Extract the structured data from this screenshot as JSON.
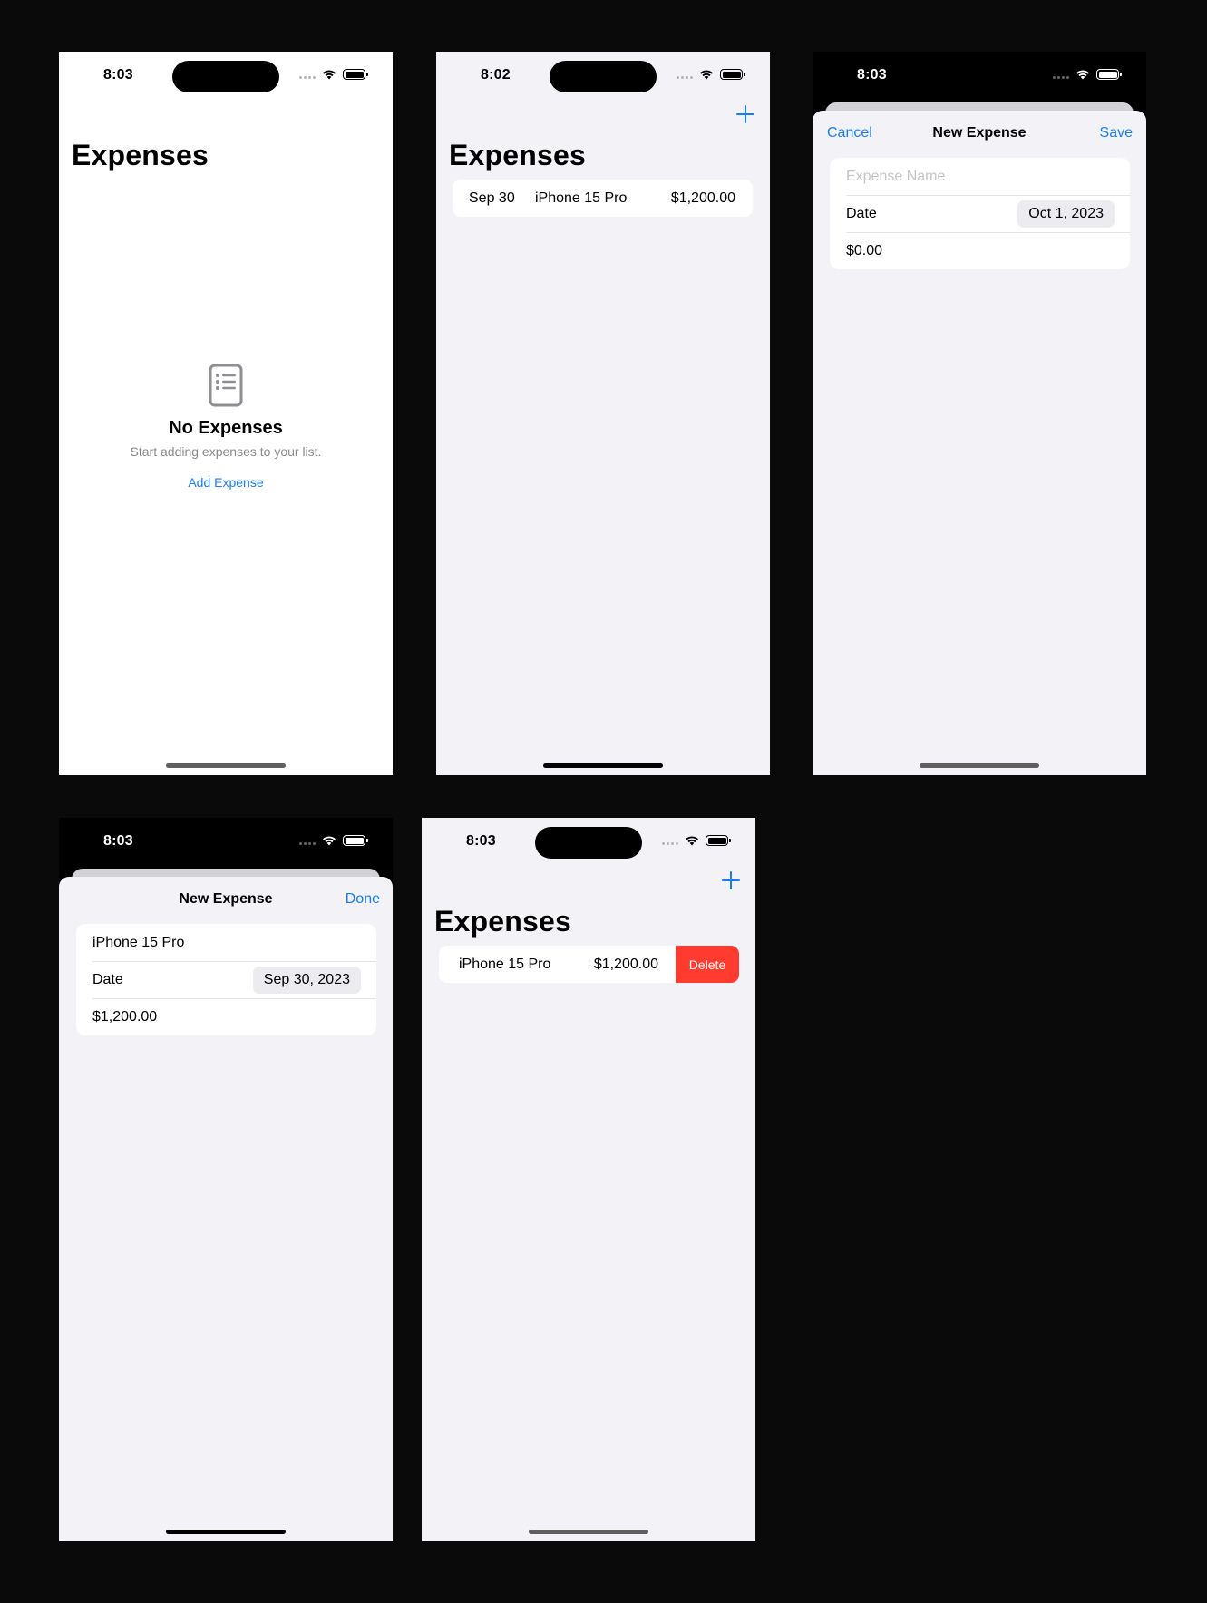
{
  "status_times": {
    "p1": "8:03",
    "p2": "8:02",
    "p3": "8:03",
    "p4": "8:03",
    "p5": "8:03"
  },
  "nav_title": "Expenses",
  "empty_state": {
    "icon": "list-document-icon",
    "title": "No Expenses",
    "subtitle": "Start adding expenses to your list.",
    "button": "Add Expense"
  },
  "list": {
    "row": {
      "date": "Sep 30",
      "name": "iPhone 15 Pro",
      "amount": "$1,200.00"
    }
  },
  "new_sheet": {
    "cancel": "Cancel",
    "title": "New Expense",
    "save": "Save",
    "name_placeholder": "Expense Name",
    "date_label": "Date",
    "date_value": "Oct 1, 2023",
    "amount_value": "$0.00"
  },
  "edit_sheet": {
    "title": "New Expense",
    "done": "Done",
    "name_value": "iPhone 15 Pro",
    "date_label": "Date",
    "date_value": "Sep 30, 2023",
    "amount_value": "$1,200.00"
  },
  "swipe": {
    "name": "iPhone 15 Pro",
    "amount": "$1,200.00",
    "delete": "Delete"
  },
  "colors": {
    "accent": "#1a7cf5",
    "destructive": "#ff3b30",
    "grouped_bg": "#f2f2f7"
  }
}
